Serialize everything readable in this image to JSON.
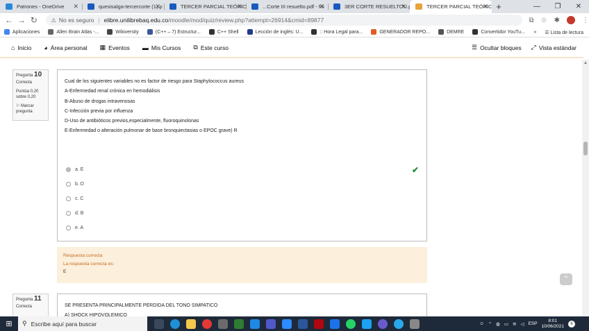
{
  "browser": {
    "tabs": [
      {
        "title": "Patrones - OneDrive",
        "color": "#2b88d8",
        "active": false
      },
      {
        "title": "quesisalga-tercercorte (1).p",
        "color": "#185abd",
        "active": false
      },
      {
        "title": "TERCER PARCIAL TEÓRICO",
        "color": "#185abd",
        "active": false
      },
      {
        "title": "...Corte III resuelto.pdf - Mi",
        "color": "#185abd",
        "active": false
      },
      {
        "title": "3ER CORTE RESUELTOU.pdf",
        "color": "#185abd",
        "active": false
      },
      {
        "title": "TERCER PARCIAL TEÓRICO",
        "color": "#e8a33d",
        "active": true
      }
    ],
    "new_tab": "+",
    "window_controls": {
      "minimize": "—",
      "maximize": "❐",
      "close": "✕"
    },
    "nav": {
      "back": "←",
      "forward": "→",
      "reload": "↻"
    },
    "address": {
      "security_text": "No es seguro",
      "host": "elibre.unilibrebaq.edu.co",
      "path": "/moodle/mod/quiz/review.php?attempt=26914&cmid=89877"
    },
    "bookmarks": [
      {
        "label": "Aplicaciones",
        "color": "#4285f4"
      },
      {
        "label": "Allen Brain Atlas -...",
        "color": "#666"
      },
      {
        "label": "Wikiversity",
        "color": "#444"
      },
      {
        "label": "(C++ – 7) Estructur...",
        "color": "#3b5998"
      },
      {
        "label": "C++ Shell",
        "color": "#333"
      },
      {
        "label": "Lección de inglés: U...",
        "color": "#1e3a8a"
      },
      {
        "label": ":: Hora Legal para...",
        "color": "#333"
      },
      {
        "label": "GENERADOR REPO...",
        "color": "#e25c1f"
      },
      {
        "label": "DEMRE",
        "color": "#555"
      },
      {
        "label": "Convertidor YouTu...",
        "color": "#333"
      }
    ],
    "bookmarks_more": "»",
    "reading_list": "Lista de lectura"
  },
  "moodle_nav": {
    "home": "Inicio",
    "personal": "Área personal",
    "events": "Eventos",
    "courses": "Mis Cursos",
    "course": "Este curso",
    "hide_blocks": "Ocultar bloques",
    "standard_view": "Vista estándar"
  },
  "question10": {
    "label": "Pregunta",
    "number": "10",
    "status": "Correcta",
    "score": "Puntúa 0,20 sobre 0,20",
    "flag": "Marcar pregunta",
    "stem": [
      "Cual de los siguientes variables no es factor de riesgo para Staphylococcus aureus",
      "A-Enfermedad renal crónica en hemodiálisis",
      "B-Abuso de drogas intravenosas",
      "C-Infección previa por influenza",
      "D-Uso de antibióticos previos,especialmente, fluoroquinolonas",
      "E-Enfermedad o alteración pulmonar de base bronquiectasias o EPOC grave)  R"
    ],
    "options": [
      "a. E",
      "b. D",
      "c. C",
      "d. B",
      "e. A"
    ],
    "selected_index": 0,
    "feedback": {
      "title": "Respuesta correcta",
      "answer_label": "La respuesta correcta es:",
      "answer": "E"
    }
  },
  "question11": {
    "label": "Pregunta",
    "number": "11",
    "status": "Correcta",
    "stem": [
      "SE PRESENTA PRINCIPALMENTE PERDIDA DEL TONO SIMPATICO",
      "A)  SHOCK HIPOVOLEMICO"
    ]
  },
  "taskbar": {
    "search_placeholder": "Escribe aquí para buscar",
    "language": "ESP",
    "time": "8:01",
    "date": "10/06/2021",
    "notifications": "6"
  }
}
